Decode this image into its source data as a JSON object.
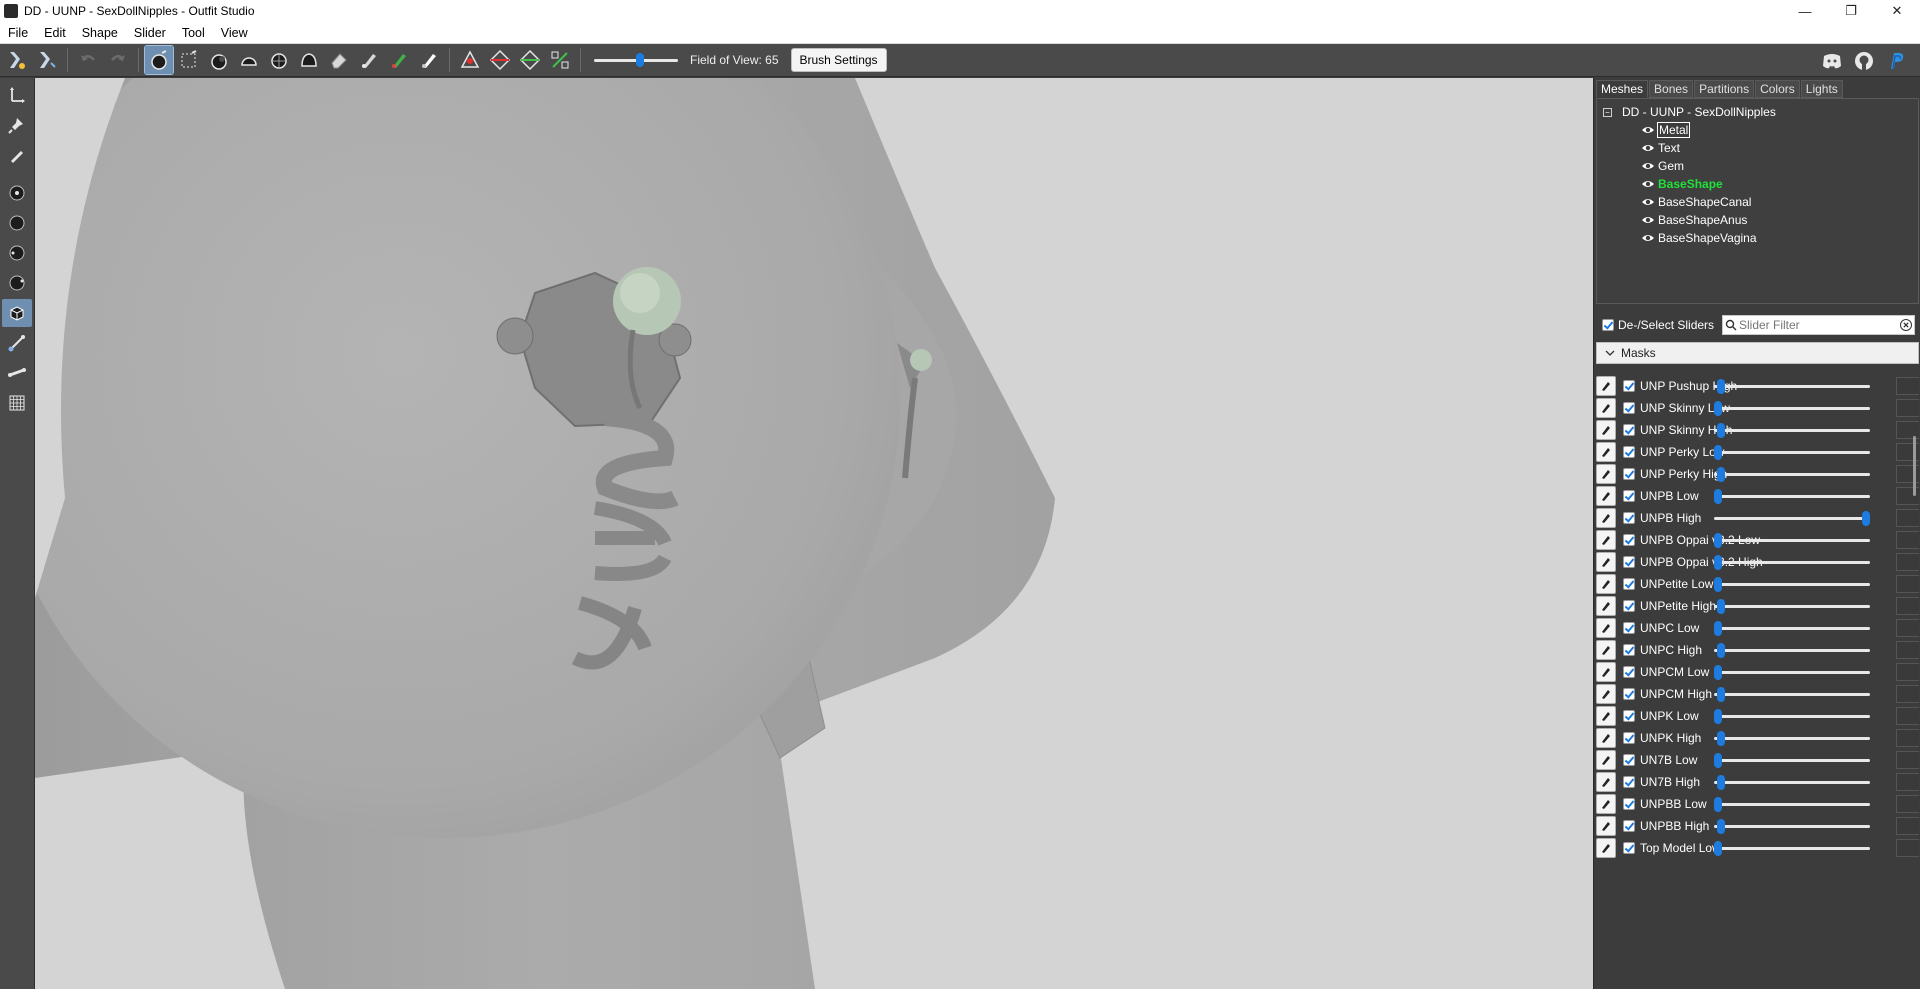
{
  "window": {
    "title": "DD - UUNP - SexDollNipples - Outfit Studio",
    "minimize_glyph": "—",
    "maximize_glyph": "❐",
    "close_glyph": "✕"
  },
  "menu": [
    "File",
    "Edit",
    "Shape",
    "Slider",
    "Tool",
    "View"
  ],
  "toolbar": {
    "field_of_view_label": "Field of View: 65",
    "fov_value": 65,
    "fov_range": [
      10,
      150
    ],
    "brush_settings_label": "Brush Settings",
    "active_tool": "inflate-brush",
    "icons": [
      "select-tool-icon",
      "transform-tool-icon",
      "undo-icon",
      "redo-icon",
      "inflate-brush-icon",
      "mask-brush-icon",
      "deflate-brush-icon",
      "move-brush-icon",
      "smooth-brush-icon",
      "undiff-brush-icon",
      "delete-brush-icon",
      "weight-brush-icon",
      "color-brush-icon",
      "alpha-brush-icon",
      "collapse-vertex-icon",
      "flip-edge-icon",
      "split-edge-icon",
      "move-vertex-icon"
    ],
    "right_icons": [
      "discord-icon",
      "github-icon",
      "paypal-icon"
    ]
  },
  "colors": {
    "accent": "#1e7be0",
    "selected_mesh": "#22e03a",
    "panel_bg": "#3c3c3c",
    "viewport_bg": "#d4d4d4"
  },
  "panel": {
    "tabs": [
      "Meshes",
      "Bones",
      "Partitions",
      "Colors",
      "Lights"
    ],
    "active_tab": "Meshes",
    "tree_root": "DD - UUNP - SexDollNipples",
    "meshes": [
      {
        "name": "Metal",
        "state": "selected"
      },
      {
        "name": "Text",
        "state": "normal"
      },
      {
        "name": "Gem",
        "state": "normal"
      },
      {
        "name": "BaseShape",
        "state": "reference"
      },
      {
        "name": "BaseShapeCanal",
        "state": "normal"
      },
      {
        "name": "BaseShapeAnus",
        "state": "normal"
      },
      {
        "name": "BaseShapeVagina",
        "state": "normal"
      }
    ],
    "deselect_label": "De-/Select Sliders",
    "filter_placeholder": "Slider Filter",
    "masks_label": "Masks"
  },
  "sliders": [
    {
      "name": "UNP Pushup High",
      "value": 0.02
    },
    {
      "name": "UNP Skinny Low",
      "value": 0.0
    },
    {
      "name": "UNP Skinny High",
      "value": 0.02
    },
    {
      "name": "UNP Perky Low",
      "value": 0.0
    },
    {
      "name": "UNP Perky High",
      "value": 0.02
    },
    {
      "name": "UNPB Low",
      "value": 0.0
    },
    {
      "name": "UNPB High",
      "value": 1.0
    },
    {
      "name": "UNPB Oppai v3.2 Low",
      "value": 0.0
    },
    {
      "name": "UNPB Oppai v3.2 High",
      "value": 0.0
    },
    {
      "name": "UNPetite Low",
      "value": 0.0
    },
    {
      "name": "UNPetite High",
      "value": 0.02
    },
    {
      "name": "UNPC Low",
      "value": 0.0
    },
    {
      "name": "UNPC High",
      "value": 0.02
    },
    {
      "name": "UNPCM Low",
      "value": 0.0
    },
    {
      "name": "UNPCM High",
      "value": 0.02
    },
    {
      "name": "UNPK Low",
      "value": 0.0
    },
    {
      "name": "UNPK High",
      "value": 0.02
    },
    {
      "name": "UN7B Low",
      "value": 0.0
    },
    {
      "name": "UN7B High",
      "value": 0.02
    },
    {
      "name": "UNPBB Low",
      "value": 0.0
    },
    {
      "name": "UNPBB High",
      "value": 0.02
    },
    {
      "name": "Top Model Low",
      "value": 0.0
    }
  ]
}
